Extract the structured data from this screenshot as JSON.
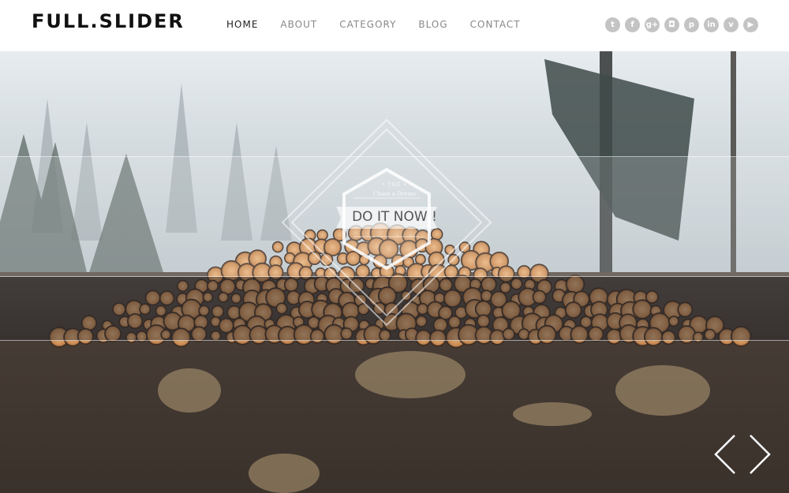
{
  "header": {
    "logo": "FULL.SLIDER",
    "nav": [
      {
        "label": "HOME",
        "active": true
      },
      {
        "label": "ABOUT",
        "active": false
      },
      {
        "label": "CATEGORY",
        "active": false
      },
      {
        "label": "BLOG",
        "active": false
      },
      {
        "label": "CONTACT",
        "active": false
      }
    ],
    "social": [
      {
        "icon": "twitter-icon",
        "glyph": "t"
      },
      {
        "icon": "facebook-icon",
        "glyph": "f"
      },
      {
        "icon": "google-plus-icon",
        "glyph": "g+"
      },
      {
        "icon": "instagram-icon",
        "glyph": "◘"
      },
      {
        "icon": "pinterest-icon",
        "glyph": "p"
      },
      {
        "icon": "linkedin-icon",
        "glyph": "in"
      },
      {
        "icon": "vimeo-icon",
        "glyph": "v"
      },
      {
        "icon": "youtube-icon",
        "glyph": "▶"
      }
    ]
  },
  "slide": {
    "badge_top": "• THE •",
    "badge_sub": "Chase a Dream",
    "badge_title": "DO IT NOW !",
    "prev_label": "Previous slide",
    "next_label": "Next slide"
  },
  "colors": {
    "logo": "#111111",
    "nav_active": "#222222",
    "nav": "#888888",
    "social_bg": "#c4c4c4"
  }
}
